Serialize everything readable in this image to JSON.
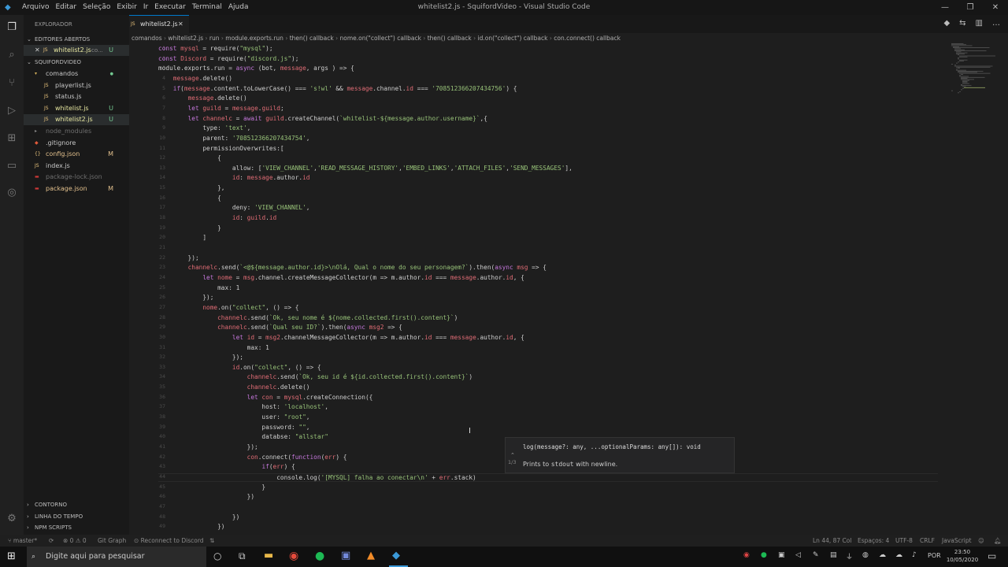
{
  "window": {
    "title": "whitelist2.js - SquifordVideo - Visual Studio Code",
    "menu": [
      "Arquivo",
      "Editar",
      "Seleção",
      "Exibir",
      "Ir",
      "Executar",
      "Terminal",
      "Ajuda"
    ]
  },
  "sidebar": {
    "explorer_title": "EXPLORADOR",
    "open_editors": "EDITORES ABERTOS",
    "open_file": "whitelist2.js",
    "open_file_dir": "co...",
    "open_file_badge": "U",
    "project": "SQUIFORDVIDEO",
    "items": [
      {
        "label": "comandos",
        "icon": "folder-open-icon",
        "badge": "",
        "color": "#c7c7c7",
        "indent": 1
      },
      {
        "label": "playerlist.js",
        "icon": "js-icon",
        "badge": "",
        "color": "#c7c7c7",
        "indent": 2
      },
      {
        "label": "status.js",
        "icon": "js-icon",
        "badge": "",
        "color": "#c7c7c7",
        "indent": 2
      },
      {
        "label": "whitelist.js",
        "icon": "js-icon",
        "badge": "U",
        "color": "#e6e6a0",
        "indent": 2
      },
      {
        "label": "whitelist2.js",
        "icon": "js-icon",
        "badge": "U",
        "color": "#e6e6a0",
        "indent": 2
      },
      {
        "label": "node_modules",
        "icon": "folder-icon",
        "badge": "",
        "color": "#6e6e6e",
        "indent": 1
      },
      {
        "label": ".gitignore",
        "icon": "git-icon",
        "badge": "",
        "color": "#c7c7c7",
        "indent": 1
      },
      {
        "label": "config.json",
        "icon": "json-icon",
        "badge": "M",
        "color": "#e2c08d",
        "indent": 1
      },
      {
        "label": "index.js",
        "icon": "js-icon",
        "badge": "",
        "color": "#c7c7c7",
        "indent": 1
      },
      {
        "label": "package-lock.json",
        "icon": "npm-icon",
        "badge": "",
        "color": "#6e6e6e",
        "indent": 1
      },
      {
        "label": "package.json",
        "icon": "npm-icon",
        "badge": "M",
        "color": "#e2c08d",
        "indent": 1
      }
    ],
    "panels": [
      "CONTORNO",
      "LINHA DO TEMPO",
      "NPM SCRIPTS"
    ]
  },
  "tab": {
    "label": "whitelist2.js"
  },
  "breadcrumbs": [
    "comandos",
    "whitelist2.js",
    "run",
    "module.exports.run",
    "then() callback",
    "nome.on(\"collect\") callback",
    "then() callback",
    "id.on(\"collect\") callback",
    "con.connect() callback"
  ],
  "code": [
    "const mysql = require(\"mysql\");",
    "const Discord = require(\"discord.js\");",
    "module.exports.run = async (bot, message, args ) => {",
    "    message.delete()",
    "    if(message.content.toLowerCase() === 's!wl' && message.channel.id === '708512366207434756') {",
    "        message.delete()",
    "        let guild = message.guild;",
    "        let channelc = await guild.createChannel(`whitelist-${message.author.username}`,{",
    "            type: 'text',",
    "            parent: '708512366207434754',",
    "            permissionOverwrites:[",
    "                {",
    "                    allow: ['VIEW_CHANNEL','READ_MESSAGE_HISTORY','EMBED_LINKS','ATTACH_FILES','SEND_MESSAGES'],",
    "                    id: message.author.id",
    "                },",
    "                {",
    "                    deny: 'VIEW_CHANNEL',",
    "                    id: guild.id",
    "                }",
    "            ]",
    "",
    "        });",
    "        channelc.send(`<@${message.author.id}>\\nOlá, Qual o nome do seu personagem?`).then(async msg => {",
    "            let nome = msg.channel.createMessageCollector(m => m.author.id === message.author.id, {",
    "                max: 1",
    "            });",
    "            nome.on(\"collect\", () => {",
    "                channelc.send(`Ok, seu nome é ${nome.collected.first().content}`)",
    "                channelc.send(`Qual seu ID?`).then(async msg2 => {",
    "                    let id = msg2.channelMessageCollector(m => m.author.id === message.author.id, {",
    "                        max: 1",
    "                    });",
    "                    id.on(\"collect\", () => {",
    "                        channelc.send(`Ok, seu id é ${id.collected.first().content}`)",
    "                        channelc.delete()",
    "                        let con = mysql.createConnection({",
    "                            host: 'localhost',",
    "                            user: \"root\",",
    "                            password: \"\",",
    "                            databse: \"allstar\"",
    "                        });",
    "                        con.connect(function(err) {",
    "                            if(err) {",
    "                                console.log('[MYSQL] falha ao conectar\\n' + err.stack)",
    "                            }",
    "                        })",
    "",
    "                    })",
    "                })"
  ],
  "line_start": 1,
  "hover": {
    "signature": "log(message?: any, ...optionalParams: any[]): void",
    "counter": "1/3",
    "doc_prefix": "Prints to",
    "doc_code": "stdout",
    "doc_suffix": "with newline."
  },
  "statusbar": {
    "branch": "master*",
    "errors": "⊗ 0 ⚠ 0",
    "git_graph": "Git Graph",
    "discord": "Reconnect to Discord",
    "position": "Ln 44, 87 Col",
    "spaces": "Espaços: 4",
    "encoding": "UTF-8",
    "eol": "CRLF",
    "language": "JavaScript"
  },
  "taskbar": {
    "search_placeholder": "Digite aqui para pesquisar",
    "lang": "POR",
    "time": "23:50",
    "date": "10/05/2020"
  },
  "colors": {
    "accent": "#007acc",
    "keyword": "#c678dd",
    "variable": "#e06c75",
    "string": "#98c379",
    "function": "#61afef"
  }
}
